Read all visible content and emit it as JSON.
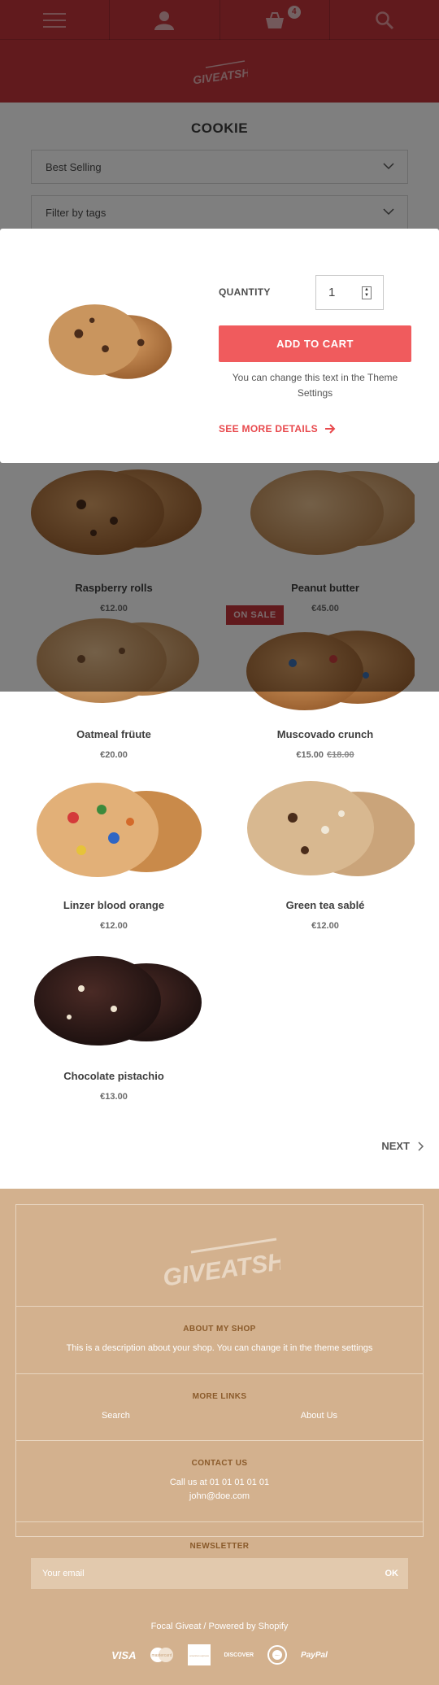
{
  "header": {
    "logo_text": "GIVEATSHOP",
    "cart_count": "4",
    "icons": [
      "menu-icon",
      "user-icon",
      "cart-icon",
      "search-icon"
    ]
  },
  "collection": {
    "title": "COOKIE",
    "sort_value": "Best Selling",
    "filter_placeholder": "Filter by tags"
  },
  "quick_view": {
    "quantity_label": "QUANTITY",
    "quantity_value": "1",
    "add_to_cart": "ADD TO CART",
    "note_line1": "You can change this text in the Theme",
    "note_line2": "Settings",
    "see_more": "SEE MORE DETAILS"
  },
  "products": [
    {
      "name": "Raspberry rolls",
      "price": "€12.00"
    },
    {
      "name": "Peanut butter",
      "price": "€45.00"
    },
    {
      "name": "Oatmeal früute",
      "price": "€20.00"
    },
    {
      "name": "Muscovado crunch",
      "price": "€15.00",
      "compare_price": "€18.00",
      "badge": "ON SALE"
    },
    {
      "name": "Linzer blood orange",
      "price": "€12.00"
    },
    {
      "name": "Green tea sablé",
      "price": "€12.00"
    },
    {
      "name": "Chocolate pistachio",
      "price": "€13.00"
    }
  ],
  "pagination": {
    "next_label": "NEXT"
  },
  "footer": {
    "logo_text": "GIVEATSHOP",
    "about_heading": "ABOUT MY SHOP",
    "about_text": "This is a description about your shop. You can change it in the theme settings",
    "links_heading": "MORE LINKS",
    "links": [
      "Search",
      "About Us"
    ],
    "contact_heading": "CONTACT US",
    "contact_phone": "Call us at 01 01 01 01 01",
    "contact_email": "john@doe.com",
    "newsletter_heading": "NEWSLETTER",
    "newsletter_placeholder": "Your email",
    "newsletter_button": "OK",
    "powered": "Focal Giveat / Powered by Shopify",
    "payments": [
      "VISA",
      "mastercard",
      "american express",
      "DISCOVER",
      "diners",
      "PayPal"
    ]
  },
  "colors": {
    "brand_red": "#c2343b",
    "button_coral": "#f05b5d",
    "footer_tan": "#d3b18e"
  }
}
